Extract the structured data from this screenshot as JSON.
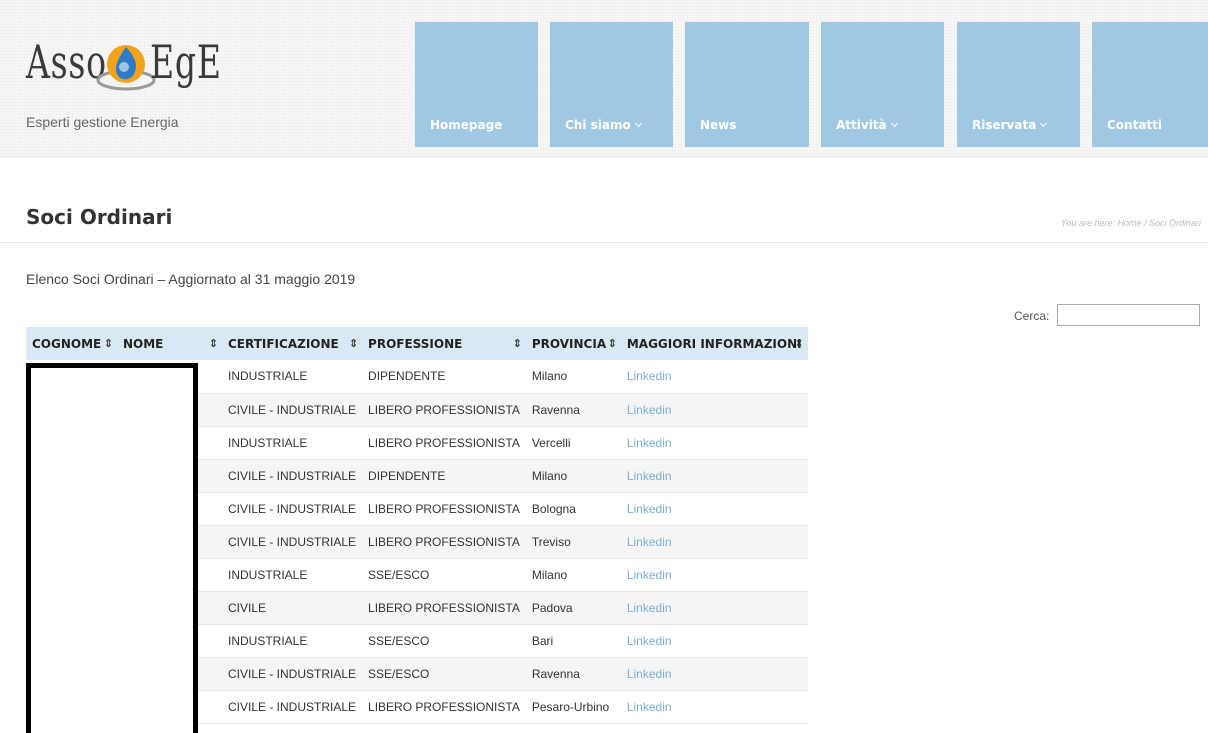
{
  "logo": {
    "word_left": "Asso",
    "word_right": "EgE",
    "tagline": "Esperti gestione Energia"
  },
  "nav": [
    {
      "label": "Homepage",
      "dropdown": false
    },
    {
      "label": "Chi siamo",
      "dropdown": true
    },
    {
      "label": "News",
      "dropdown": false
    },
    {
      "label": "Attività",
      "dropdown": true
    },
    {
      "label": "Riservata",
      "dropdown": true
    },
    {
      "label": "Contatti",
      "dropdown": false
    }
  ],
  "page": {
    "title": "Soci Ordinari",
    "breadcrumb": "You are here: Home / Soci Ordinari",
    "intro": "Elenco Soci Ordinari – Aggiornato al 31 maggio 2019"
  },
  "search": {
    "label": "Cerca:",
    "value": ""
  },
  "table": {
    "columns": [
      "COGNOME",
      "NOME",
      "CERTIFICAZIONE",
      "PROFESSIONE",
      "PROVINCIA",
      "MAGGIORI INFORMAZIONI"
    ],
    "rows": [
      {
        "cognome": "",
        "nome": "",
        "certificazione": "INDUSTRIALE",
        "professione": "DIPENDENTE",
        "provincia": "Milano",
        "info": "Linkedin"
      },
      {
        "cognome": "",
        "nome": "",
        "certificazione": "CIVILE - INDUSTRIALE",
        "professione": "LIBERO PROFESSIONISTA",
        "provincia": "Ravenna",
        "info": "Linkedin"
      },
      {
        "cognome": "",
        "nome": "",
        "certificazione": "INDUSTRIALE",
        "professione": "LIBERO PROFESSIONISTA",
        "provincia": "Vercelli",
        "info": "Linkedin"
      },
      {
        "cognome": "",
        "nome": "",
        "certificazione": "CIVILE - INDUSTRIALE",
        "professione": "DIPENDENTE",
        "provincia": "Milano",
        "info": "Linkedin"
      },
      {
        "cognome": "",
        "nome": "",
        "certificazione": "CIVILE - INDUSTRIALE",
        "professione": "LIBERO PROFESSIONISTA",
        "provincia": "Bologna",
        "info": "Linkedin"
      },
      {
        "cognome": "",
        "nome": "",
        "certificazione": "CIVILE - INDUSTRIALE",
        "professione": "LIBERO PROFESSIONISTA",
        "provincia": "Treviso",
        "info": "Linkedin"
      },
      {
        "cognome": "",
        "nome": "",
        "certificazione": "INDUSTRIALE",
        "professione": "SSE/ESCO",
        "provincia": "Milano",
        "info": "Linkedin"
      },
      {
        "cognome": "",
        "nome": "",
        "certificazione": "CIVILE",
        "professione": "LIBERO PROFESSIONISTA",
        "provincia": "Padova",
        "info": "Linkedin"
      },
      {
        "cognome": "",
        "nome": "",
        "certificazione": "INDUSTRIALE",
        "professione": "SSE/ESCO",
        "provincia": "Bari",
        "info": "Linkedin"
      },
      {
        "cognome": "",
        "nome": "",
        "certificazione": "CIVILE - INDUSTRIALE",
        "professione": "SSE/ESCO",
        "provincia": "Ravenna",
        "info": "Linkedin"
      },
      {
        "cognome": "",
        "nome": "",
        "certificazione": "CIVILE - INDUSTRIALE",
        "professione": "LIBERO PROFESSIONISTA",
        "provincia": "Pesaro-Urbino",
        "info": "Linkedin"
      }
    ]
  },
  "colors": {
    "nav_bg": "#a0c8e3",
    "header_row": "#d9e9f4",
    "link": "#7aaed6"
  }
}
